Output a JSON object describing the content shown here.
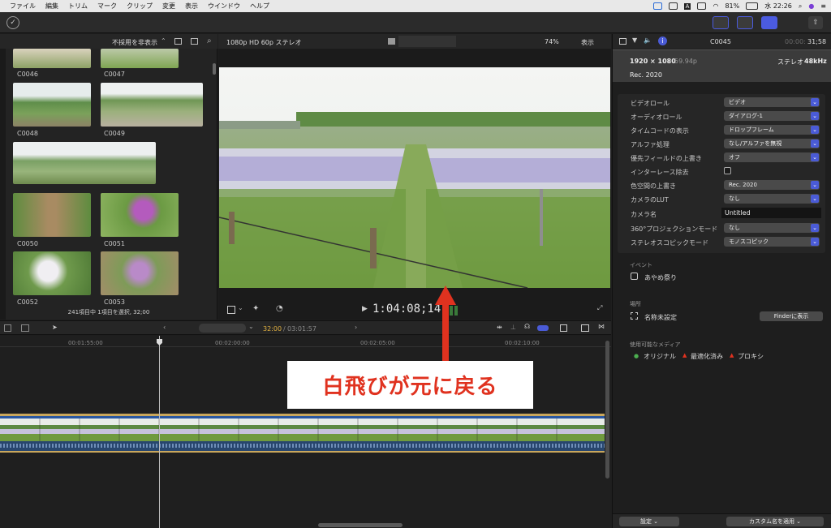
{
  "menubar": {
    "items": [
      "ファイル",
      "編集",
      "トリム",
      "マーク",
      "クリップ",
      "変更",
      "表示",
      "ウインドウ",
      "ヘルプ"
    ],
    "battery": "81%",
    "clock": "水 22:26"
  },
  "browser": {
    "filter_label": "不採用を非表示",
    "clips": [
      "C0046",
      "C0047",
      "C0048",
      "C0049",
      "C0050",
      "C0051",
      "C0052",
      "C0053"
    ],
    "footer": "241項目中 1項目を選択, 32;00"
  },
  "viewer": {
    "format": "1080p HD 60p ステレオ",
    "zoom": "74%",
    "view_menu": "表示",
    "timecode": "1:04:08;14"
  },
  "timeline": {
    "position": "32:00",
    "duration": "03:01:57",
    "ruler": [
      "00:01:55:00",
      "00:02:00:00",
      "00:02:05:00",
      "00:02:10:00"
    ]
  },
  "inspector": {
    "clip_name": "C0045",
    "duration_prefix": "00:00:",
    "duration": "31;58",
    "resolution": "1920 × 1080",
    "fps": "59.94p",
    "audio": "ステレオ",
    "sample_rate": "48kHz",
    "color_space": "Rec. 2020",
    "rows": [
      {
        "label": "ビデオロール",
        "value": "ビデオ"
      },
      {
        "label": "オーディオロール",
        "value": "ダイアログ-1"
      },
      {
        "label": "タイムコードの表示",
        "value": "ドロップフレーム"
      },
      {
        "label": "アルファ処理",
        "value": "なし/アルファを無視"
      },
      {
        "label": "優先フィールドの上書き",
        "value": "オフ"
      },
      {
        "label": "インターレース除去",
        "value": ""
      },
      {
        "label": "色空間の上書き",
        "value": "Rec. 2020"
      },
      {
        "label": "カメラのLUT",
        "value": "なし"
      },
      {
        "label": "カメラ名",
        "value": "Untitled"
      },
      {
        "label": "360°プロジェクションモード",
        "value": "なし"
      },
      {
        "label": "ステレオスコピックモード",
        "value": "モノスコピック"
      }
    ],
    "event_header": "イベント",
    "event_name": "あやめ祭り",
    "location_header": "場所",
    "location_value": "名称未設定",
    "finder_button": "Finderに表示",
    "media_header": "使用可能なメディア",
    "media_original": "オリジナル",
    "media_optimized": "最適化済み",
    "media_proxy": "プロキシ",
    "settings_button": "設定",
    "apply_button": "カスタム名を適用"
  },
  "annotation": {
    "callout": "白飛びが元に戻る"
  },
  "colors": {
    "accent": "#4a5bd6",
    "callout_text": "#e0321f",
    "arrow": "#e0321f"
  }
}
